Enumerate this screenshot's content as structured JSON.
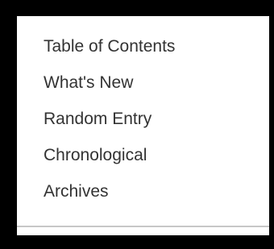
{
  "menu": {
    "items": [
      {
        "label": "Table of Contents"
      },
      {
        "label": "What's New"
      },
      {
        "label": "Random Entry"
      },
      {
        "label": "Chronological"
      },
      {
        "label": "Archives"
      }
    ]
  },
  "colors": {
    "background": "#000000",
    "panel": "#ffffff",
    "text": "#333333"
  }
}
